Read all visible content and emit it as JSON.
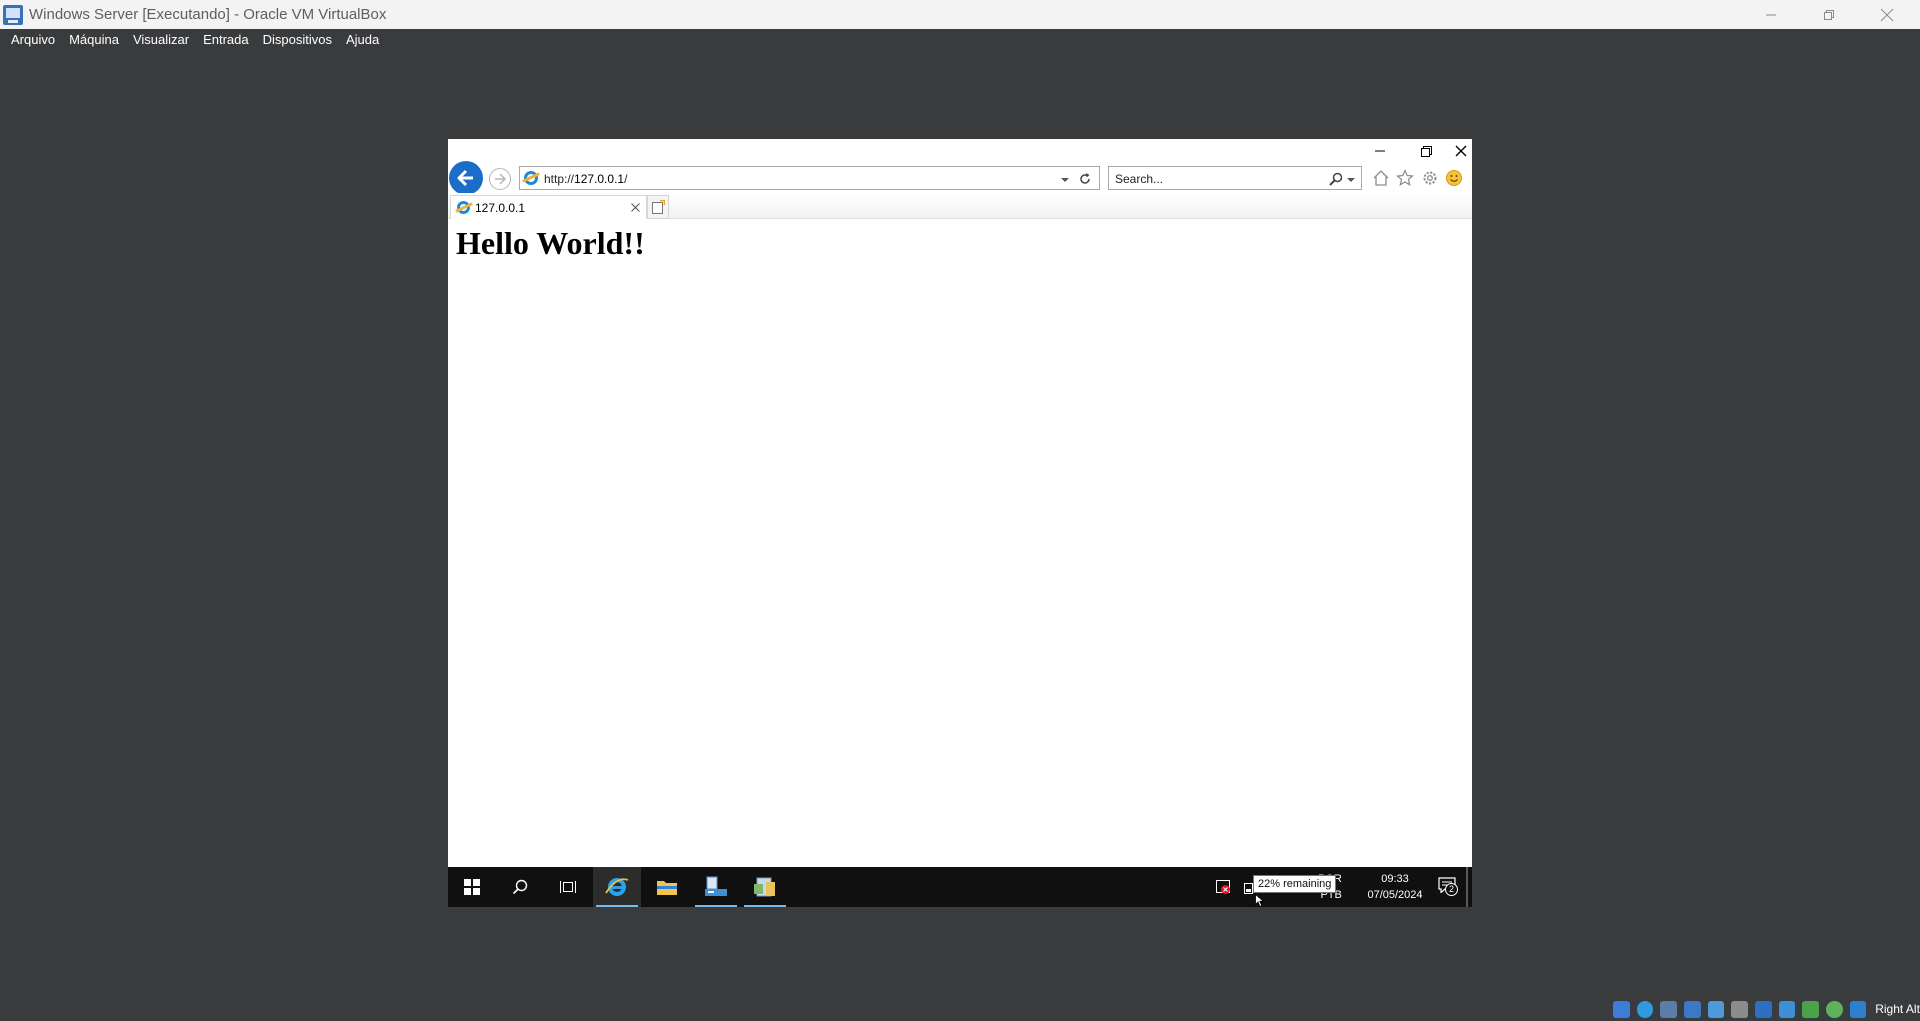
{
  "vbox": {
    "title": "Windows Server [Executando] - Oracle VM VirtualBox",
    "menu": [
      "Arquivo",
      "Máquina",
      "Visualizar",
      "Entrada",
      "Dispositivos",
      "Ajuda"
    ],
    "host_key": "Right Alt",
    "status_icons": [
      "optical-drive-icon",
      "cd-icon",
      "audio-icon",
      "network-icon",
      "usb-icon",
      "shared-folders-icon",
      "display-icon",
      "recording-icon",
      "cpu-icon",
      "mouse-integration-icon",
      "keyboard-icon"
    ]
  },
  "ie": {
    "address": {
      "scheme": "http://",
      "host": "127.0.0.1",
      "path": "/"
    },
    "search_placeholder": "Search...",
    "tab_title": "127.0.0.1"
  },
  "page": {
    "heading": "Hello World!!"
  },
  "taskbar": {
    "tooltip": "22% remaining",
    "time": "09:33",
    "date": "07/05/2024",
    "lang_partial_top": "POR",
    "lang_partial_bottom": "PTB",
    "notification_count": "2"
  },
  "colors": {
    "vbox_background": "#3a3b3d",
    "ie_accent": "#1a6dc9",
    "taskbar": "#101010",
    "taskbar_active_underline": "#76b9ed"
  }
}
